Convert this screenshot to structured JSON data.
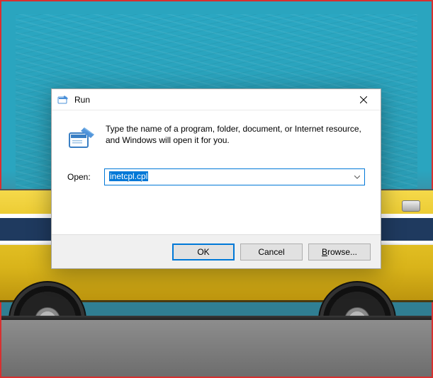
{
  "dialog": {
    "title": "Run",
    "description": "Type the name of a program, folder, document, or Internet resource, and Windows will open it for you.",
    "open_label": "Open:",
    "input_value": "inetcpl.cpl",
    "buttons": {
      "ok": "OK",
      "cancel": "Cancel",
      "browse_prefix": "B",
      "browse_rest": "rowse..."
    }
  },
  "icons": {
    "title": "run-icon",
    "main": "run-icon",
    "close": "close-icon",
    "chevron": "chevron-down-icon"
  }
}
